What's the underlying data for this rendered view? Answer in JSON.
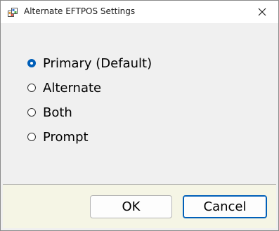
{
  "window": {
    "title": "Alternate EFTPOS Settings"
  },
  "icons": {
    "app": "app-window-icon",
    "close": "close-icon"
  },
  "options": [
    {
      "label": "Primary (Default)",
      "checked": true
    },
    {
      "label": "Alternate",
      "checked": false
    },
    {
      "label": "Both",
      "checked": false
    },
    {
      "label": "Prompt",
      "checked": false
    }
  ],
  "buttons": {
    "ok_label": "OK",
    "cancel_label": "Cancel"
  },
  "colors": {
    "accent": "#005fb8",
    "footer_bg": "#f5f5e5",
    "content_bg": "#f0f0f0"
  }
}
